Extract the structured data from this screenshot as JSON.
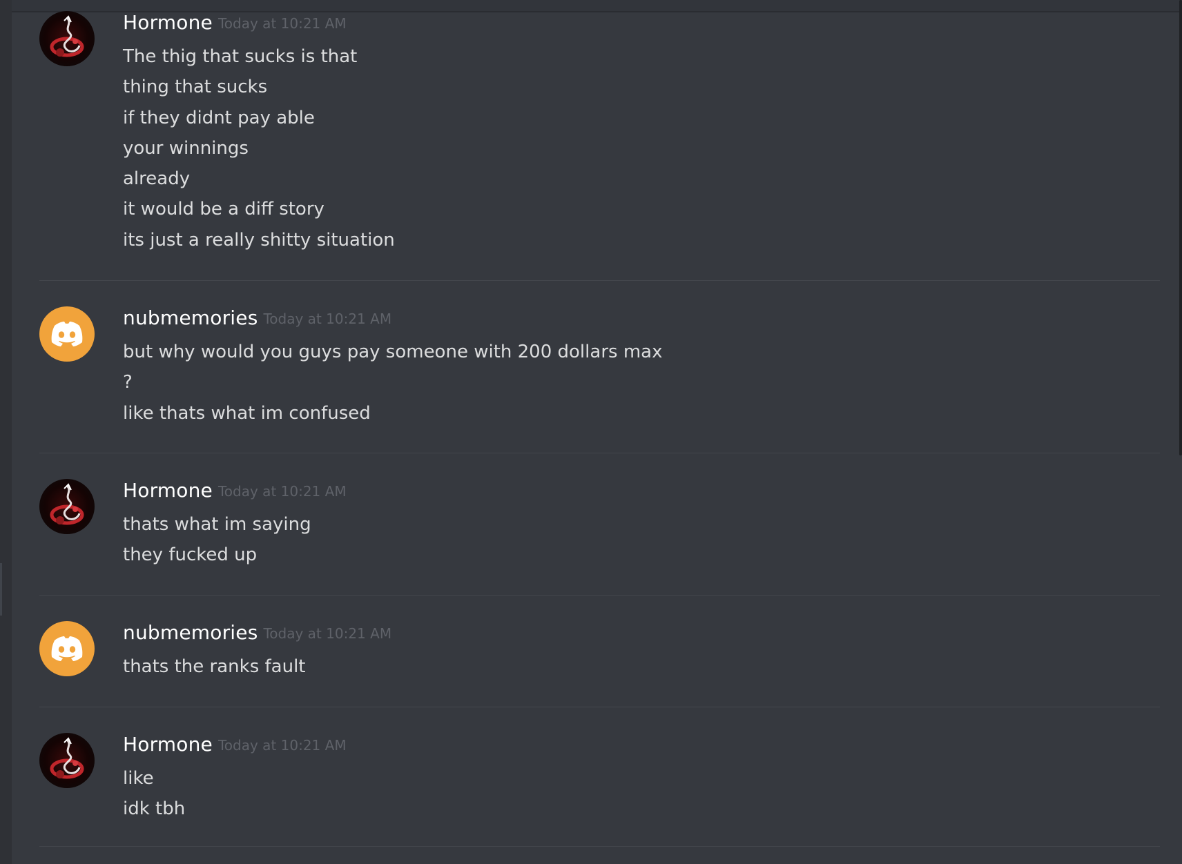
{
  "messages": [
    {
      "author": "Hormone",
      "avatar": "dragon-avatar",
      "timestamp": "Today at 10:21 AM",
      "lines": [
        "The thig that sucks is that",
        "thing that sucks",
        "if they didnt pay able",
        "your winnings",
        "already",
        "it would be a diff story",
        "its just a really shitty situation"
      ]
    },
    {
      "author": "nubmemories",
      "avatar": "discord-default-avatar",
      "timestamp": "Today at 10:21 AM",
      "lines": [
        "but why would you guys pay someone with 200 dollars max",
        "?",
        "like thats what im confused"
      ]
    },
    {
      "author": "Hormone",
      "avatar": "dragon-avatar",
      "timestamp": "Today at 10:21 AM",
      "lines": [
        "thats what im saying",
        "they fucked up"
      ]
    },
    {
      "author": "nubmemories",
      "avatar": "discord-default-avatar",
      "timestamp": "Today at 10:21 AM",
      "lines": [
        "thats the ranks fault"
      ]
    },
    {
      "author": "Hormone",
      "avatar": "dragon-avatar",
      "timestamp": "Today at 10:21 AM",
      "lines": [
        "like",
        "idk tbh"
      ]
    }
  ],
  "colors": {
    "background": "#36393f",
    "username": "#ffffff",
    "message_text": "#dcddde",
    "timestamp": "#5f6269",
    "discord_avatar": "#f1a33b",
    "divider": "#43464c"
  }
}
